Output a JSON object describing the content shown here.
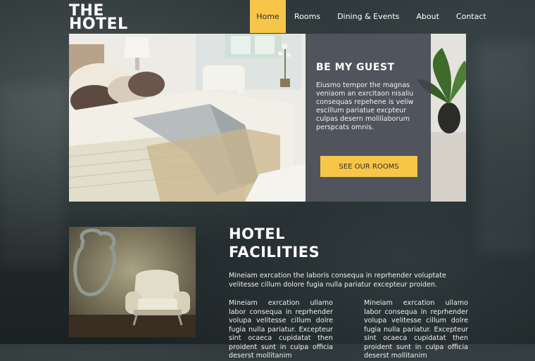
{
  "brand": {
    "line1": "THE",
    "line2": "HOTEL"
  },
  "nav": {
    "items": [
      "Home",
      "Rooms",
      "Dining & Events",
      "About",
      "Contact"
    ],
    "active": "Home"
  },
  "hero": {
    "title": "BE MY GUEST",
    "text": "Eiusmo tempor the magnas veniaom an exrcitaon nisaliu consequas repehene is veliw escillum pariatue excpteur culpas desern mollilaborum perspcats omnis.",
    "button": "SEE OUR ROOMS"
  },
  "facilities": {
    "title_line1": "HOTEL",
    "title_line2": "FACILITIES",
    "intro": "Mineiam exrcation the laboris consequa in reprhender voluptate velitesse cillum dolore fugia nulla pariatur excepteur proiden.",
    "col1": "Mineiam exrcation ullamo labor consequa in reprhender volupa velitesse cillum dolre fugia nulla pariatur. Excepteur sint ocaeca cupidatat then proident sunt in culpa officia deserst mollitanim",
    "col2": "Mineiam exrcation ullamo labor consequa in reprhender volupa velitesse cillum dolre fugia nulla pariatur. Excepteur sint ocaeca cupidatat then proident sunt in culpa officia deserst mollitanim"
  },
  "colors": {
    "accent": "#f7c548",
    "panel": "#3f444d",
    "background": "#252e30"
  }
}
